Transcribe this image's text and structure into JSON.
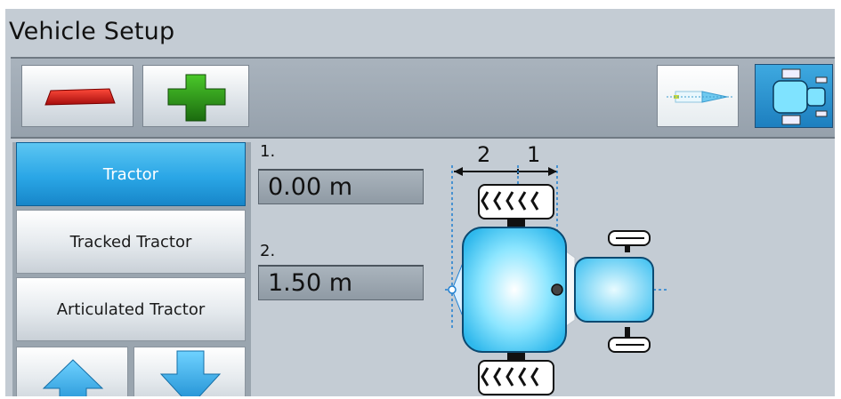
{
  "header": {
    "title": "Vehicle Setup"
  },
  "toolbar": {
    "minus_icon": "minus-icon",
    "plus_icon": "plus-icon",
    "implement_icon": "implement-view-icon",
    "vehicle_icon": "vehicle-view-icon"
  },
  "vehicle_types": [
    {
      "label": "Tractor",
      "selected": true
    },
    {
      "label": "Tracked Tractor",
      "selected": false
    },
    {
      "label": "Articulated Tractor",
      "selected": false
    }
  ],
  "scroll": {
    "up_icon": "arrow-up-icon",
    "down_icon": "arrow-down-icon"
  },
  "measurements": [
    {
      "label": "1.",
      "value": "0.00 m"
    },
    {
      "label": "2.",
      "value": "1.50 m"
    }
  ],
  "diagram": {
    "dim_label_1": "1",
    "dim_label_2": "2"
  },
  "colors": {
    "selected": "#2aa6e6",
    "minus": "#d41313",
    "plus": "#2a8f16",
    "panel": "#c4ccd4"
  }
}
